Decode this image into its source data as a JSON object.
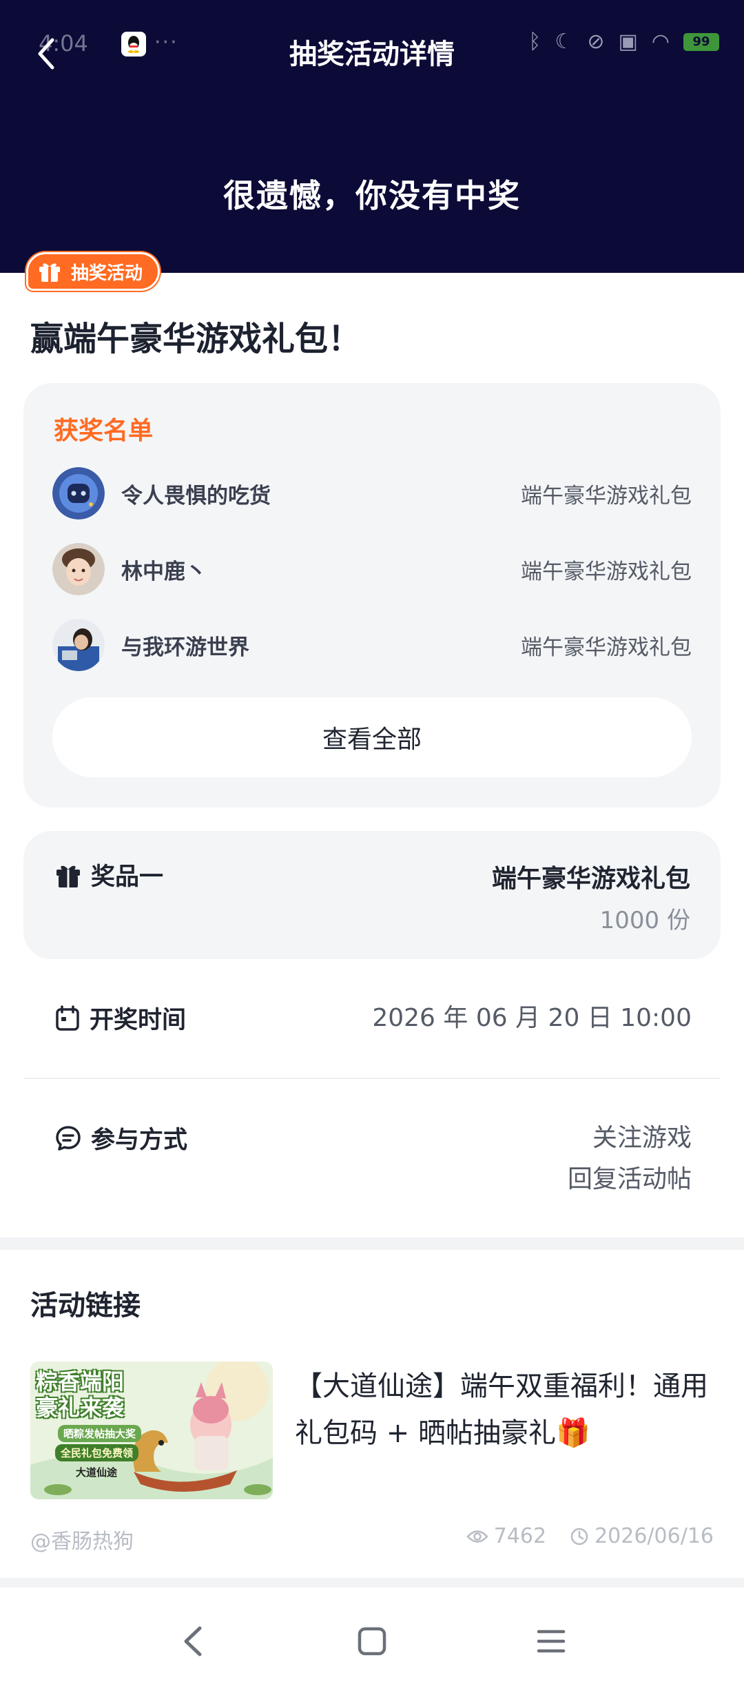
{
  "status_bar": {
    "time": "4:04",
    "dots": "···",
    "battery": "99"
  },
  "header": {
    "title": "抽奖活动详情",
    "result": "很遗憾，你没有中奖"
  },
  "post": {
    "badge": "抽奖活动",
    "title": "赢端午豪华游戏礼包！"
  },
  "winners": {
    "title": "获奖名单",
    "rows": [
      {
        "name": "令人畏惧的吃货",
        "prize": "端午豪华游戏礼包"
      },
      {
        "name": "林中鹿丶",
        "prize": "端午豪华游戏礼包"
      },
      {
        "name": "与我环游世界",
        "prize": "端午豪华游戏礼包"
      }
    ],
    "view_all": "查看全部"
  },
  "prize": {
    "label": "奖品一",
    "name": "端午豪华游戏礼包",
    "count": "1000 份"
  },
  "draw_time": {
    "label": "开奖时间",
    "value": "2026 年 06 月 20 日 10:00"
  },
  "participation": {
    "label": "参与方式",
    "line1": "关注游戏",
    "line2": "回复活动帖"
  },
  "activity_link": {
    "title": "活动链接",
    "text": "【大道仙途】端午双重福利！通用礼包码 + 晒帖抽豪礼🎁",
    "author": "@香肠热狗",
    "views": "7462",
    "date": "2026/06/16",
    "thumb_text": {
      "line1": "粽香端阳",
      "line2": "豪礼来袭",
      "line3": "晒粽发帖抽大奖",
      "line4": "全民礼包免费领",
      "logo": "大道仙途"
    }
  },
  "colors": {
    "header_bg": "#0c0a36",
    "accent": "#ff6b22",
    "card_bg": "#f4f5f7"
  }
}
